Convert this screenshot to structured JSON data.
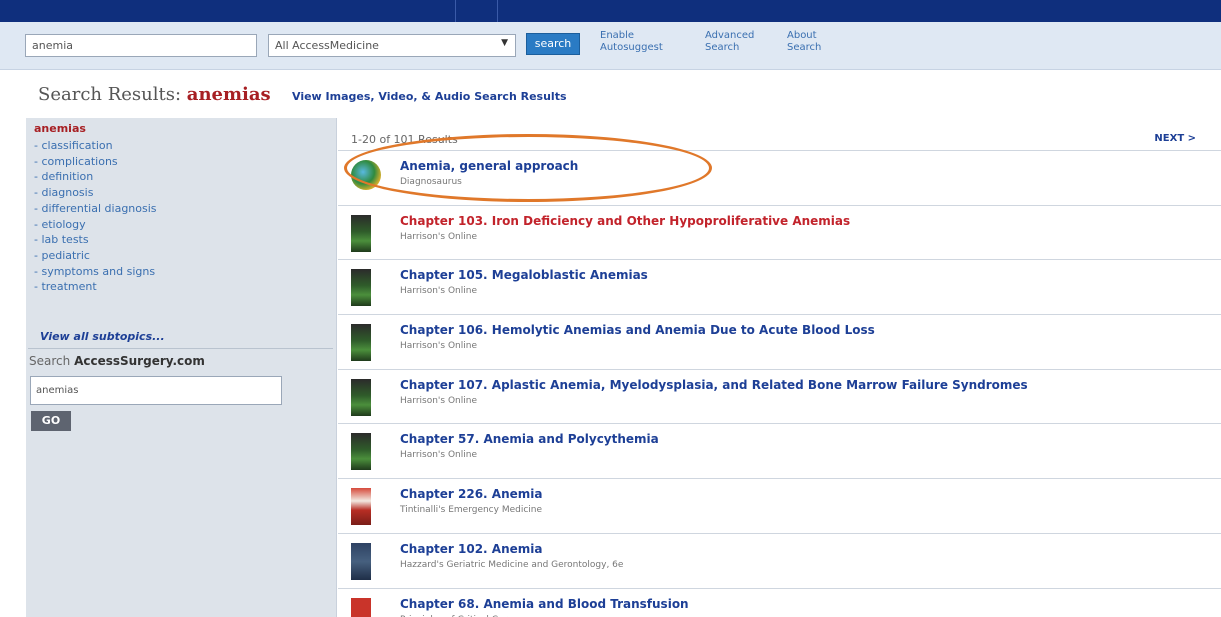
{
  "search": {
    "query": "anemia",
    "scope": "All AccessMedicine",
    "button_label": "search",
    "links": [
      {
        "line1": "Enable",
        "line2": "Autosuggest"
      },
      {
        "line1": "Advanced",
        "line2": "Search"
      },
      {
        "line1": "About",
        "line2": "Search"
      }
    ]
  },
  "heading": {
    "prefix": "Search Results:",
    "term": "anemias",
    "media_link": "View Images, Video, & Audio Search Results"
  },
  "sidebar": {
    "term": "anemias",
    "subtopics": [
      "- classification",
      "- complications",
      "- definition",
      "- diagnosis",
      "- differential diagnosis",
      "- etiology",
      "- lab tests",
      "- pediatric",
      "- symptoms and signs",
      "- treatment"
    ],
    "view_all": "View all subtopics...",
    "search_label_prefix": "Search",
    "search_label_site": "AccessSurgery.com",
    "search_value": "anemias",
    "go_label": "GO"
  },
  "results": {
    "count_text": "1-20 of 101 Results",
    "next_label": "NEXT >",
    "items": [
      {
        "title": "Anemia, general approach",
        "source": "Diagnosaurus",
        "thumb": "diagnosaurus",
        "visited": false
      },
      {
        "title": "Chapter 103. Iron Deficiency and Other Hypoproliferative Anemias",
        "source": "Harrison's Online",
        "thumb": "green-book",
        "visited": true
      },
      {
        "title": "Chapter 105. Megaloblastic Anemias",
        "source": "Harrison's Online",
        "thumb": "green-book",
        "visited": false
      },
      {
        "title": "Chapter 106. Hemolytic Anemias and Anemia Due to Acute Blood Loss",
        "source": "Harrison's Online",
        "thumb": "green-book",
        "visited": false
      },
      {
        "title": "Chapter 107. Aplastic Anemia, Myelodysplasia, and Related Bone Marrow Failure Syndromes",
        "source": "Harrison's Online",
        "thumb": "green-book",
        "visited": false
      },
      {
        "title": "Chapter 57. Anemia and Polycythemia",
        "source": "Harrison's Online",
        "thumb": "green-book",
        "visited": false
      },
      {
        "title": "Chapter 226. Anemia",
        "source": "Tintinalli's Emergency Medicine",
        "thumb": "red-book",
        "visited": false
      },
      {
        "title": "Chapter 102. Anemia",
        "source": "Hazzard's Geriatric Medicine and Gerontology, 6e",
        "thumb": "blue-book",
        "visited": false
      },
      {
        "title": "Chapter 68. Anemia and Blood Transfusion",
        "source": "Principles of Critical Care",
        "thumb": "red-cover",
        "visited": false
      }
    ]
  },
  "colors": {
    "top_bar": "#0f2f7d",
    "link_blue": "#1d3f96",
    "term_red": "#a71f23",
    "highlight": "#e0782a"
  }
}
